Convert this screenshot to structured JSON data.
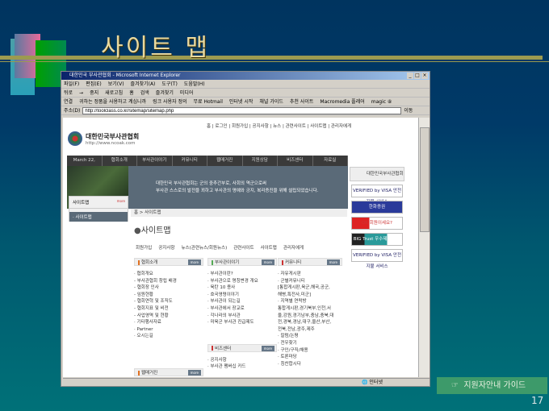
{
  "slide": {
    "title": "사이트 맵",
    "guide": "지원자안내 가이드",
    "guide_icon": "pointing-hand-icon",
    "page_number": "17"
  },
  "browser": {
    "title": "대한민국 부사관협회 - Microsoft Internet Explorer",
    "menu": [
      "파일(F)",
      "편집(E)",
      "보기(V)",
      "즐겨찾기(A)",
      "도구(T)",
      "도움말(H)"
    ],
    "toolbar": [
      "뒤로",
      "→",
      "중지",
      "새로고침",
      "홈",
      "검색",
      "즐겨찾기",
      "미디어"
    ],
    "links_label": "연결",
    "links": [
      "귀하는 정품을 사용하고 계십니까",
      "링크 사용자 정의",
      "무료 Hotmail",
      "인터넷 시작",
      "채널 가이드",
      "추천 사이트",
      "Macromedia 플레어",
      "magic ⑧"
    ],
    "address_label": "주소(D)",
    "address": "http://toolclass.co.kr/sitemap/sitemap.php",
    "go": "이동",
    "status": "인터넷"
  },
  "site": {
    "top_links": "홈 | 로그인 | 회원가입 | 공지사항 | 뉴스 | 관련사이트 | 사이트맵 | 관리자에게",
    "org_name": "대한민국부사관협회",
    "org_url": "http://www.ncoak.com",
    "nav": [
      "March 22, 2002",
      "협회소개",
      "부사관이야기",
      "커뮤니티",
      "웹매거진",
      "지원상담",
      "비즈센터",
      "자료실"
    ],
    "banner_line1": "대한민국 부사관협회는 군의 중추간부로, 사회의 역군으로써",
    "banner_line2": "부사관 스스로의 발전을 꾀하고 부사관의 명예와 긍지, 복리증진을 위해 설립되었습니다.",
    "side_title": "사이트맵",
    "side_more": "more",
    "side_item": "· 사이트맵",
    "breadcrumb": "홈 > 사이트맵",
    "page_title": "사이트맵",
    "tabs": [
      "회원가입",
      "공지사항",
      "뉴스(관련뉴스/회원뉴스)",
      "관련사이트",
      "사이트맵",
      "관리자에게"
    ],
    "more": "more",
    "columns": [
      {
        "title": "협회소개",
        "items": [
          "· 협회개요",
          "- 부사관협회 창립 배경",
          "- 협회장 인사",
          "- 임원현황",
          "- 협회연혁 및 조직도",
          "- 협회지표 및 비전",
          "- 사업영역 및 현황",
          "· 기타행사자료",
          "· Partner",
          "· 오시는길"
        ]
      },
      {
        "title": "부사관이야기",
        "items": [
          "· 부사관이란?",
          "· 부사관으로 명칭변경 개요",
          "· 육탄 10 용사",
          "· 호국영령이야기",
          "· 부사관이 되는길",
          "· 부사관에서 장교로",
          "· 각나라의 부사관",
          "· 미육군 부사관 진급제도"
        ]
      },
      {
        "title": "커뮤니티",
        "items": [
          "· 자유게시판",
          "· 군별커뮤니티",
          "[통합게시판,육군,해국,공군,",
          "해병,특전사,미군]",
          "· 지역별 연락방",
          "통합게시판,경기북부,인천,서",
          "울,강원,경기남부,충남,충북,대",
          "전,경북,경남,대구,울산,부산,",
          "전북,전남,광주,제주",
          "· 칼럼/논평",
          "· 전우찾기",
          "· 구인/구직/채용",
          "· 토론마당",
          "· 칭찬합시다"
        ]
      },
      {
        "title": "비즈센터",
        "items": [
          "· 공지사항",
          "· 부사관 팸버십 카드"
        ]
      },
      {
        "title": "웹매거진",
        "items": []
      }
    ],
    "right_title": "대한민국부사관협회",
    "right_banners": [
      "VERIFIED by VISA 안전 지불 서비스",
      "한화증권",
      "OK 회원이세요?",
      "BIG Trust 우수제품 추천보상",
      "VERIFIED by VISA 안전 지불 서비스"
    ]
  }
}
